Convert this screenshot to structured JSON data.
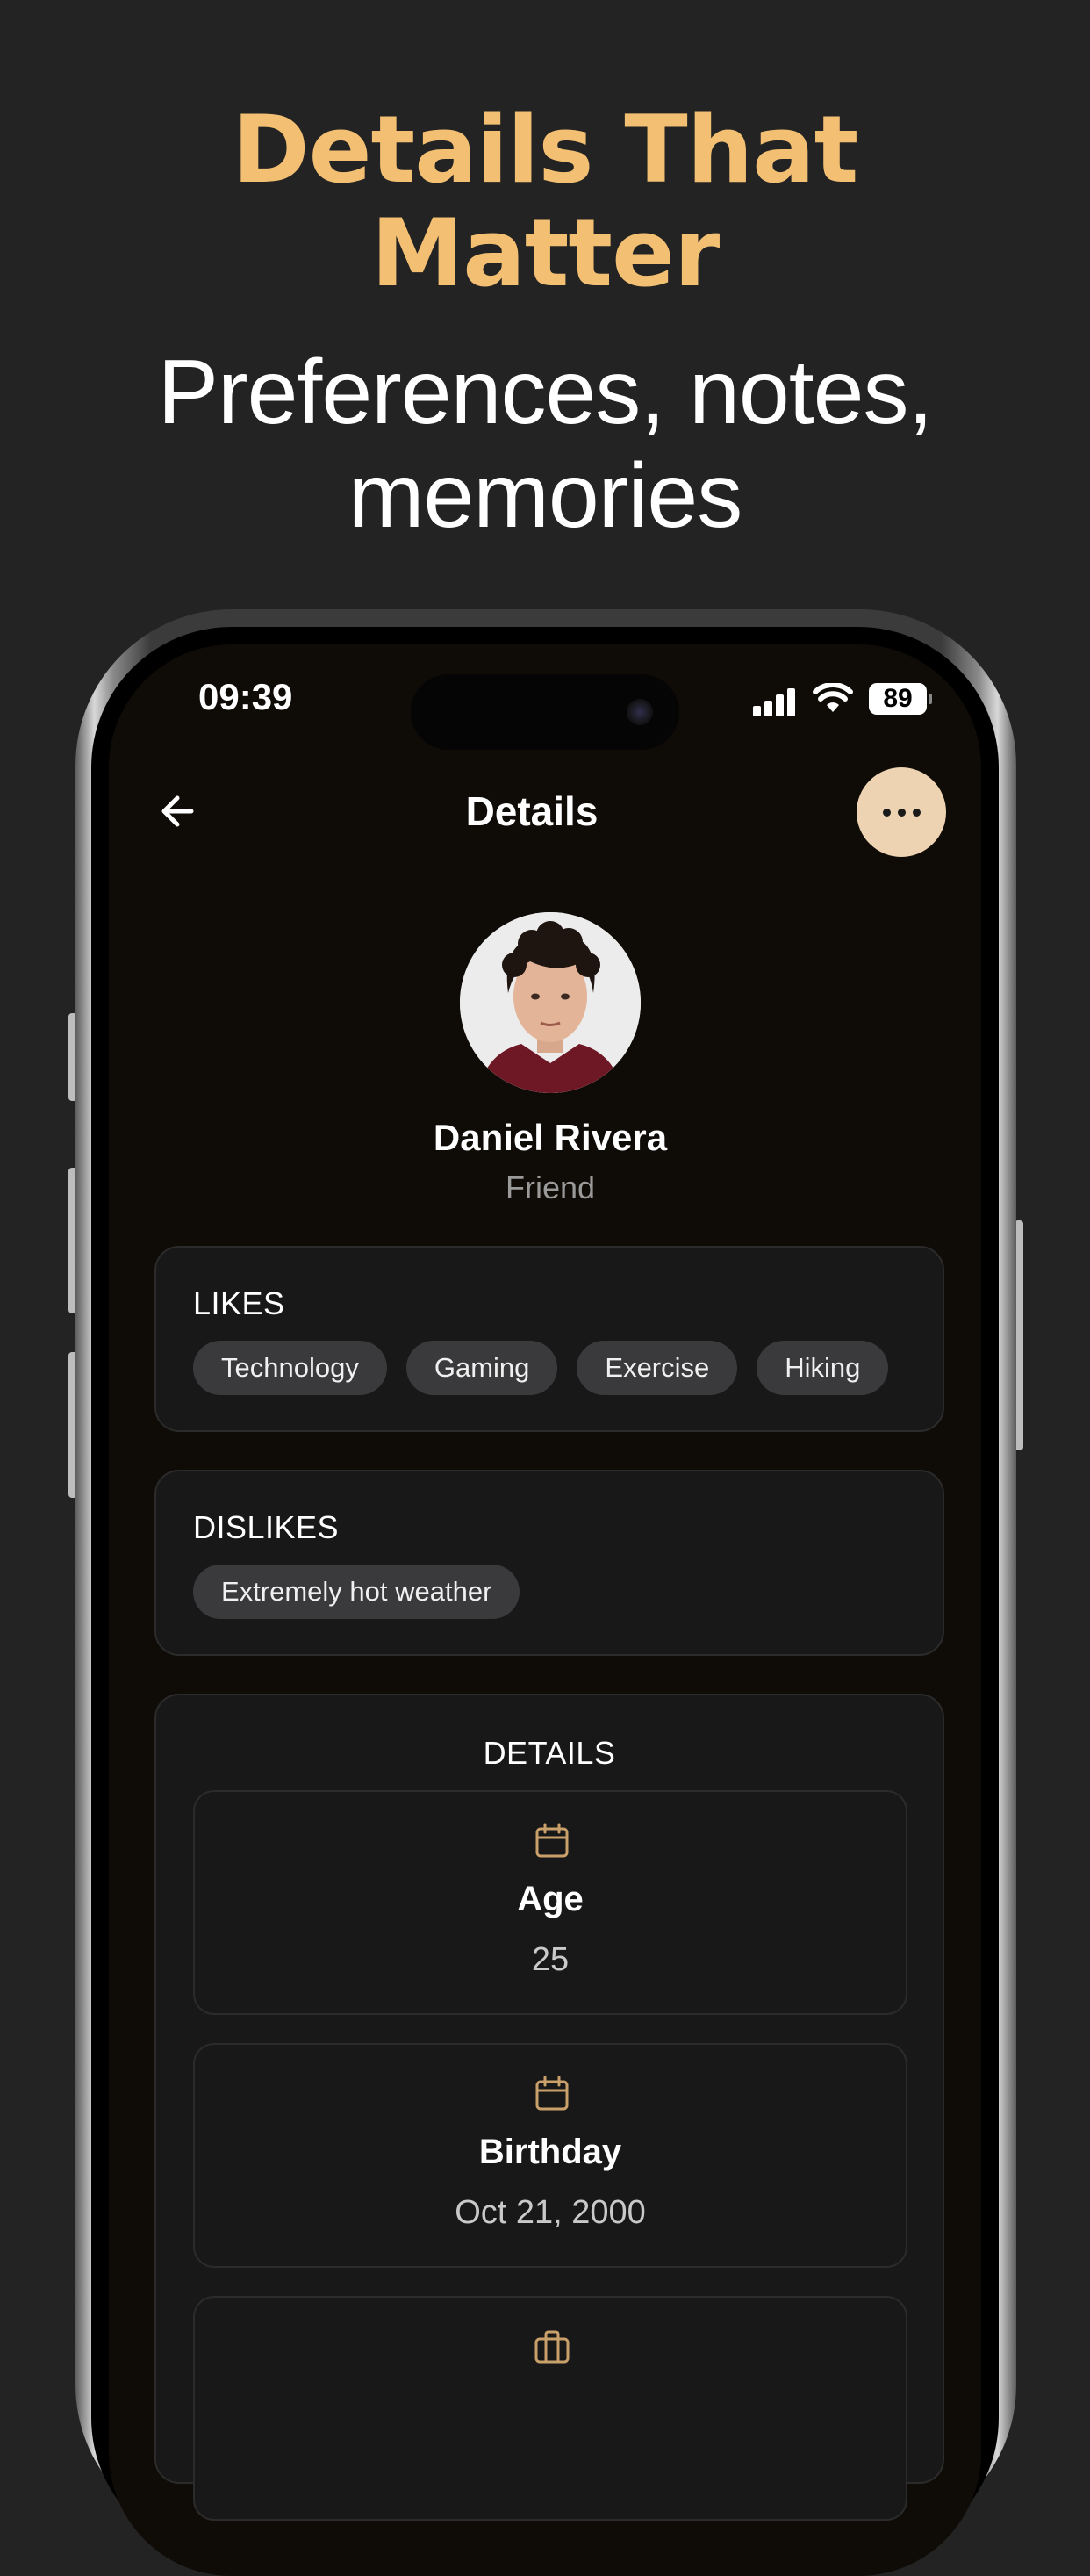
{
  "headline": {
    "line1": "Details That",
    "line2": "Matter"
  },
  "subheadline": {
    "line1": "Preferences, notes,",
    "line2": "memories"
  },
  "status_bar": {
    "time": "09:39",
    "battery": "89"
  },
  "nav": {
    "title": "Details",
    "back_icon": "arrow-left-icon",
    "more_icon": "more-horizontal-icon"
  },
  "profile": {
    "name": "Daniel Rivera",
    "relation": "Friend"
  },
  "likes": {
    "label": "LIKES",
    "items": [
      "Technology",
      "Gaming",
      "Exercise",
      "Hiking"
    ]
  },
  "dislikes": {
    "label": "DISLIKES",
    "items": [
      "Extremely hot weather"
    ]
  },
  "details": {
    "title": "DETAILS",
    "items": [
      {
        "label": "Age",
        "value": "25",
        "icon": "calendar-icon"
      },
      {
        "label": "Birthday",
        "value": "Oct 21, 2000",
        "icon": "calendar-icon"
      },
      {
        "icon": "briefcase-icon"
      }
    ]
  },
  "colors": {
    "accent": "#F2BF73",
    "background": "#232323",
    "screen": "#0F0B07",
    "card": "#181818",
    "chip": "#3a3a3c",
    "more_button": "#EDD3B1"
  }
}
